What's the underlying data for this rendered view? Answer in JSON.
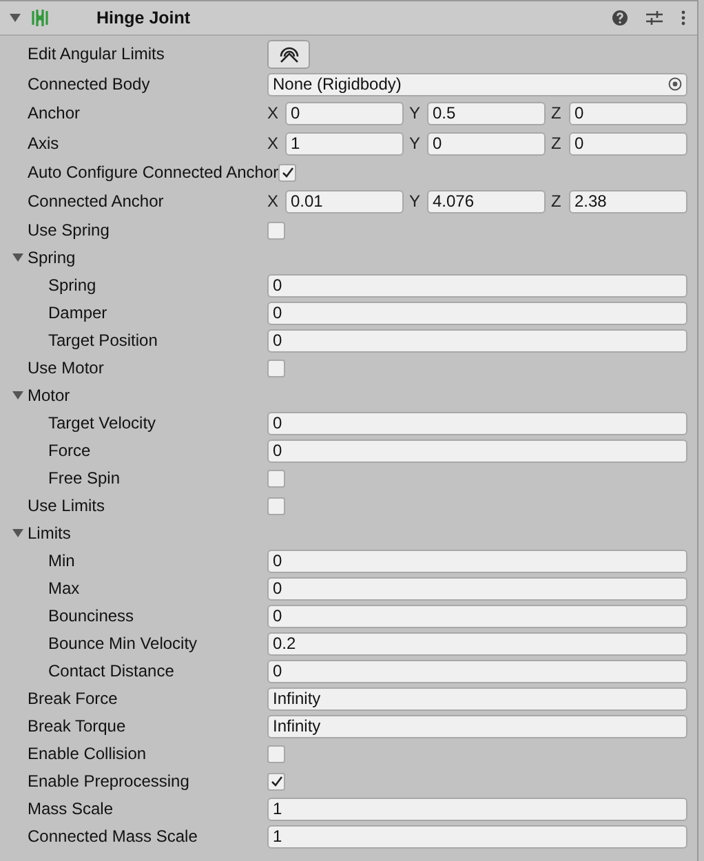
{
  "component": {
    "title": "Hinge Joint",
    "expanded": true
  },
  "rows": [
    {
      "kind": "button",
      "label": "Edit Angular Limits"
    },
    {
      "kind": "object",
      "label": "Connected Body",
      "value": "None (Rigidbody)"
    },
    {
      "kind": "vector3",
      "label": "Anchor",
      "axes": [
        {
          "axis": "X",
          "value": "0"
        },
        {
          "axis": "Y",
          "value": "0.5"
        },
        {
          "axis": "Z",
          "value": "0"
        }
      ]
    },
    {
      "kind": "vector3",
      "label": "Axis",
      "axes": [
        {
          "axis": "X",
          "value": "1"
        },
        {
          "axis": "Y",
          "value": "0"
        },
        {
          "axis": "Z",
          "value": "0"
        }
      ]
    },
    {
      "kind": "toggle",
      "label": "Auto Configure Connected Anchor",
      "checked": true
    },
    {
      "kind": "vector3",
      "label": "Connected Anchor",
      "axes": [
        {
          "axis": "X",
          "value": "0.01"
        },
        {
          "axis": "Y",
          "value": "4.076"
        },
        {
          "axis": "Z",
          "value": "2.38"
        }
      ]
    },
    {
      "kind": "toggle",
      "label": "Use Spring",
      "checked": false
    },
    {
      "kind": "foldout",
      "label": "Spring",
      "expanded": true,
      "children": [
        {
          "kind": "float",
          "label": "Spring",
          "value": "0"
        },
        {
          "kind": "float",
          "label": "Damper",
          "value": "0"
        },
        {
          "kind": "float",
          "label": "Target Position",
          "value": "0"
        }
      ]
    },
    {
      "kind": "toggle",
      "label": "Use Motor",
      "checked": false
    },
    {
      "kind": "foldout",
      "label": "Motor",
      "expanded": true,
      "children": [
        {
          "kind": "float",
          "label": "Target Velocity",
          "value": "0"
        },
        {
          "kind": "float",
          "label": "Force",
          "value": "0"
        },
        {
          "kind": "toggle",
          "label": "Free Spin",
          "checked": false
        }
      ]
    },
    {
      "kind": "toggle",
      "label": "Use Limits",
      "checked": false
    },
    {
      "kind": "foldout",
      "label": "Limits",
      "expanded": true,
      "children": [
        {
          "kind": "float",
          "label": "Min",
          "value": "0"
        },
        {
          "kind": "float",
          "label": "Max",
          "value": "0"
        },
        {
          "kind": "float",
          "label": "Bounciness",
          "value": "0"
        },
        {
          "kind": "float",
          "label": "Bounce Min Velocity",
          "value": "0.2"
        },
        {
          "kind": "float",
          "label": "Contact Distance",
          "value": "0"
        }
      ]
    },
    {
      "kind": "float",
      "label": "Break Force",
      "value": "Infinity"
    },
    {
      "kind": "float",
      "label": "Break Torque",
      "value": "Infinity"
    },
    {
      "kind": "toggle",
      "label": "Enable Collision",
      "checked": false
    },
    {
      "kind": "toggle",
      "label": "Enable Preprocessing",
      "checked": true
    },
    {
      "kind": "float",
      "label": "Mass Scale",
      "value": "1"
    },
    {
      "kind": "float",
      "label": "Connected Mass Scale",
      "value": "1"
    }
  ]
}
